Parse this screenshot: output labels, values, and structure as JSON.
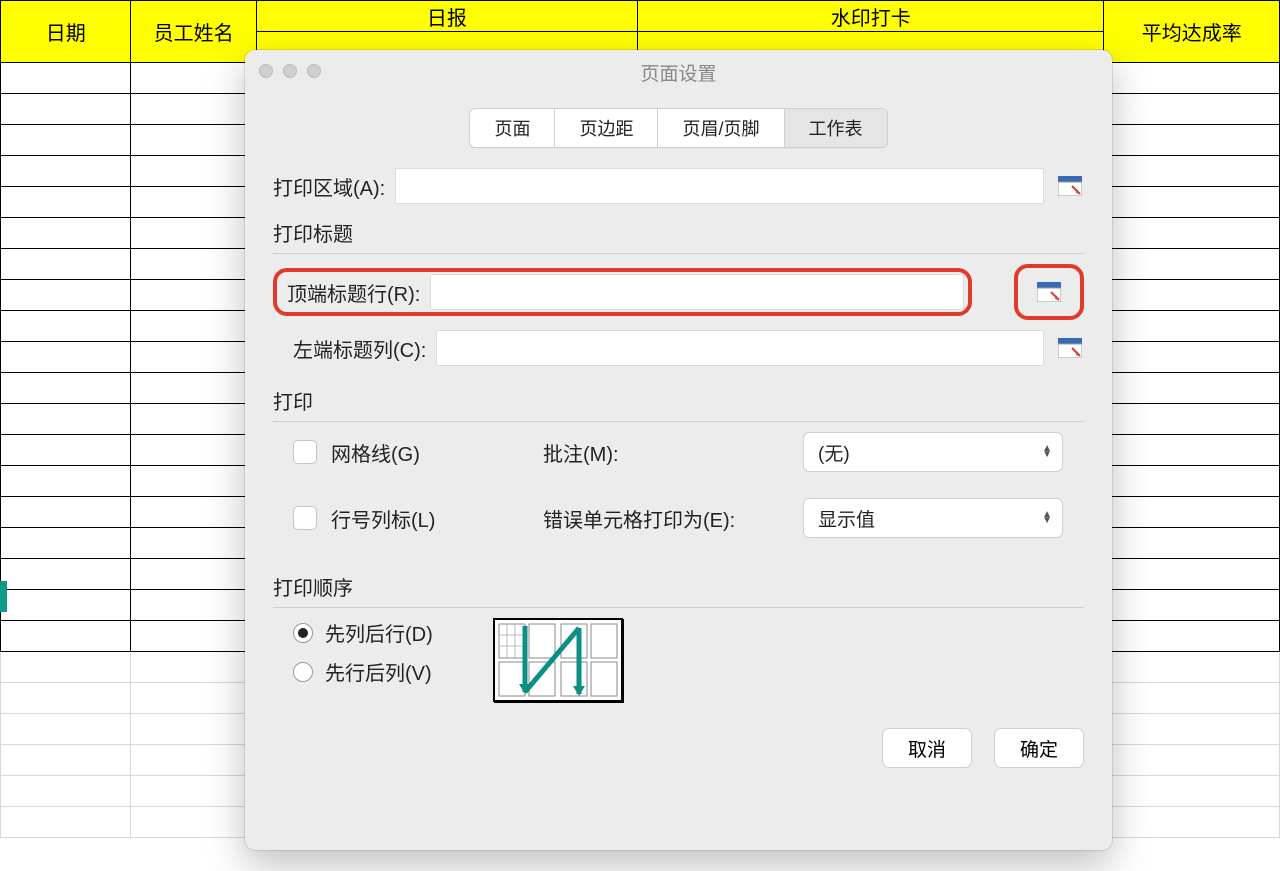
{
  "sheet": {
    "headers": {
      "date": "日期",
      "employee": "员工姓名",
      "daily_report": "日报",
      "watermark_checkin": "水印打卡",
      "avg_rate": "平均达成率"
    }
  },
  "dialog": {
    "title": "页面设置",
    "tabs": {
      "page": "页面",
      "margins": "页边距",
      "header_footer": "页眉/页脚",
      "sheet": "工作表"
    },
    "print_area_label": "打印区域(A):",
    "print_area_value": "",
    "print_titles_section": "打印标题",
    "top_rows_label": "顶端标题行(R):",
    "top_rows_value": "",
    "left_cols_label": "左端标题列(C):",
    "left_cols_value": "",
    "print_section": "打印",
    "gridlines": "网格线(G)",
    "rowcol_headings": "行号列标(L)",
    "comments_label": "批注(M):",
    "comments_value": "(无)",
    "errors_label": "错误单元格打印为(E):",
    "errors_value": "显示值",
    "order_section": "打印顺序",
    "order_down_over": "先列后行(D)",
    "order_over_down": "先行后列(V)",
    "cancel": "取消",
    "ok": "确定"
  }
}
